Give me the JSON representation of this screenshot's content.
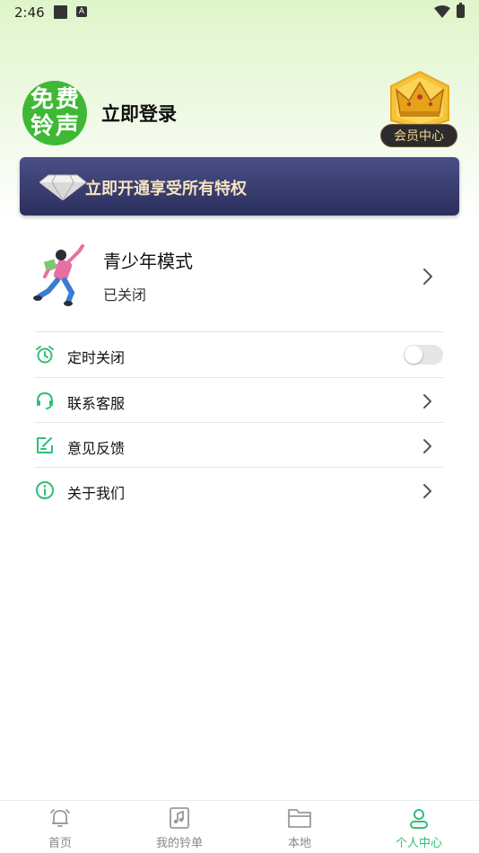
{
  "status_bar": {
    "time": "2:46",
    "notif_icon": "A"
  },
  "profile": {
    "logo_chars": [
      "免",
      "费",
      "铃",
      "声"
    ],
    "login_label": "立即登录",
    "vip_center_label": "会员中心"
  },
  "vip_banner": {
    "text": "立即开通享受所有特权"
  },
  "teen_mode": {
    "title": "青少年模式",
    "status": "已关闭"
  },
  "menu": [
    {
      "label": "定时关闭",
      "icon": "alarm-clock-icon",
      "control": "toggle",
      "toggle_on": false
    },
    {
      "label": "联系客服",
      "icon": "headset-icon",
      "control": "chevron"
    },
    {
      "label": "意见反馈",
      "icon": "edit-note-icon",
      "control": "chevron"
    },
    {
      "label": "关于我们",
      "icon": "info-icon",
      "control": "chevron"
    }
  ],
  "bottom_nav": [
    {
      "label": "首页",
      "icon": "bell-icon",
      "active": false
    },
    {
      "label": "我的铃单",
      "icon": "music-note-icon",
      "active": false
    },
    {
      "label": "本地",
      "icon": "folder-icon",
      "active": false
    },
    {
      "label": "个人中心",
      "icon": "person-icon",
      "active": true
    }
  ],
  "colors": {
    "accent": "#2fbf77",
    "logo_green": "#3fb835",
    "banner": "#363a6e",
    "banner_text": "#f6e4bf"
  }
}
